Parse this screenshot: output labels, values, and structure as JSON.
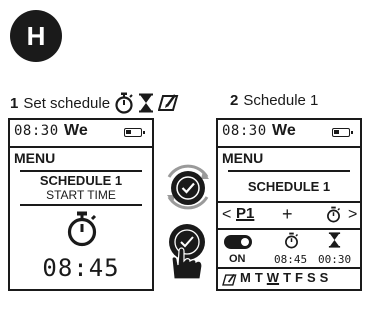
{
  "badge": {
    "letter": "H"
  },
  "step1": {
    "number": "1",
    "label": "Set schedule",
    "icons": [
      "stopwatch-icon",
      "hourglass-icon",
      "calendar-edit-icon"
    ],
    "screen": {
      "time": "08:30",
      "day": "We",
      "menu": "MENU",
      "title": "SCHEDULE 1",
      "subtitle": "START TIME",
      "big_icon": "stopwatch-icon",
      "value": "08:45"
    }
  },
  "middle": {
    "icons": [
      "rotate-arrows-icon",
      "checkmark-button-icon",
      "hand-press-icon"
    ]
  },
  "step2": {
    "number": "2",
    "label": "Schedule 1",
    "screen": {
      "time": "08:30",
      "day": "We",
      "menu": "MENU",
      "title": "SCHEDULE 1",
      "nav": {
        "prev": "<",
        "p1": "P1",
        "plus": "+",
        "next": ">"
      },
      "toggle_label": "ON",
      "start_time": "08:45",
      "duration": "00:30",
      "days": [
        "M",
        "T",
        "W",
        "T",
        "F",
        "S",
        "S"
      ],
      "highlight_day": "W"
    }
  },
  "colors": {
    "ink": "#1a1a1a",
    "background": "#ffffff"
  }
}
